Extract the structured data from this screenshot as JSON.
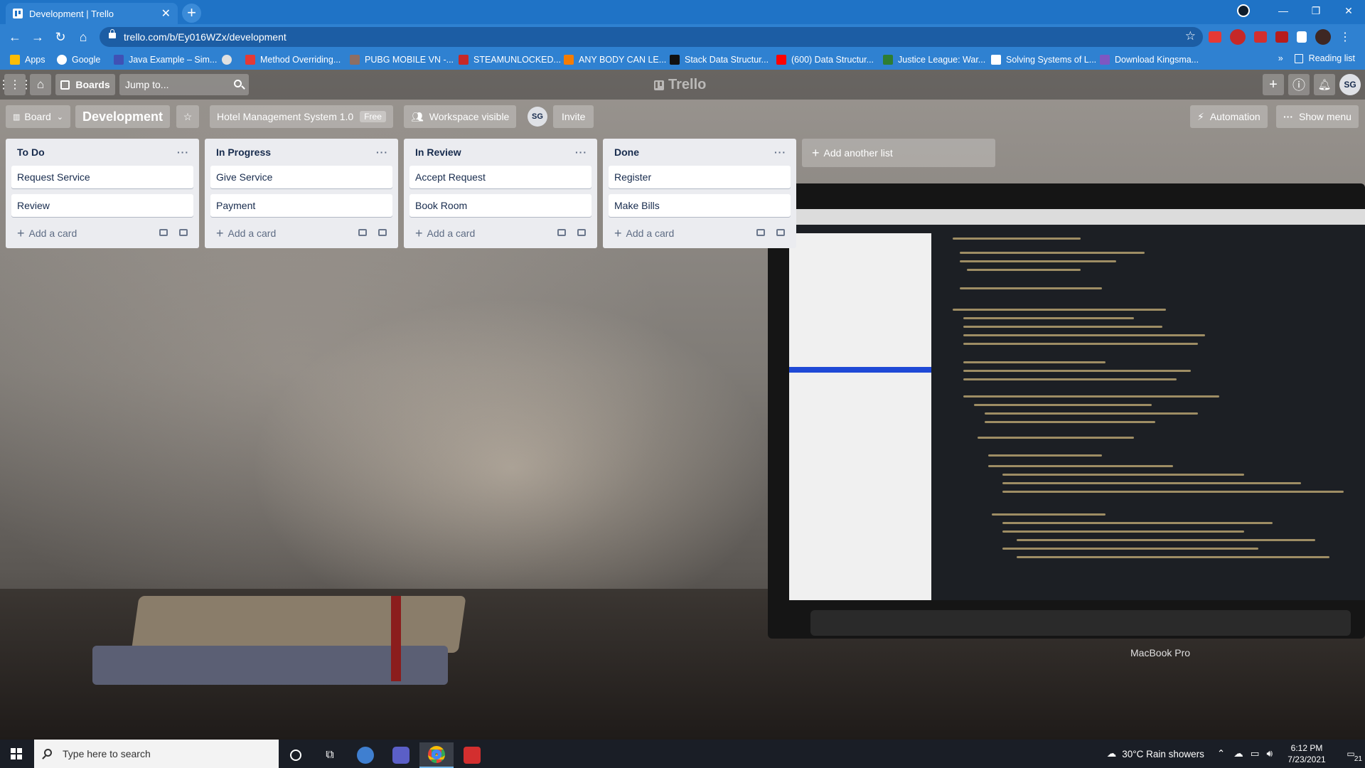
{
  "browser": {
    "tab_title": "Development | Trello",
    "tab_close": "✕",
    "new_tab": "+",
    "url": "trello.com/b/Ey016WZx/development",
    "window_controls": [
      "—",
      "❐",
      "✕"
    ]
  },
  "bookmarks": [
    {
      "label": "Apps",
      "color": "#fbbc05"
    },
    {
      "label": "Google",
      "color": "#ffffff"
    },
    {
      "label": "Java Example – Sim...",
      "color": "#3f51b5"
    },
    {
      "label": "",
      "color": "#e0e0e0"
    },
    {
      "label": "Method Overriding...",
      "color": "#e53935"
    },
    {
      "label": "PUBG MOBILE VN -...",
      "color": "#8d6e63"
    },
    {
      "label": "STEAMUNLOCKED...",
      "color": "#c62828"
    },
    {
      "label": "ANY BODY CAN LE...",
      "color": "#f57c00"
    },
    {
      "label": "Stack Data Structur...",
      "color": "#111111"
    },
    {
      "label": "(600) Data Structur...",
      "color": "#ff0000"
    },
    {
      "label": "Justice League: War...",
      "color": "#2e7d32"
    },
    {
      "label": "Solving Systems of L...",
      "color": "#ffffff"
    },
    {
      "label": "Download Kingsma...",
      "color": "#7e57c2"
    }
  ],
  "bookmarks_overflow": "»",
  "reading_list": "Reading list",
  "trello_header": {
    "boards_label": "Boards",
    "search_placeholder": "Jump to...",
    "logo_text": "Trello",
    "user_initials": "SG",
    "create_icon": "+",
    "info_icon": "ⓘ"
  },
  "board_bar": {
    "view_label": "Board",
    "board_name": "Development",
    "workspace_name": "Hotel Management System 1.0",
    "workspace_badge": "Free",
    "visibility_label": "Workspace visible",
    "member_initials": "SG",
    "invite_label": "Invite",
    "automation_label": "Automation",
    "show_menu_label": "Show menu"
  },
  "lists": [
    {
      "title": "To Do",
      "cards": [
        "Request Service",
        "Review"
      ]
    },
    {
      "title": "In Progress",
      "cards": [
        "Give Service",
        "Payment"
      ]
    },
    {
      "title": "In Review",
      "cards": [
        "Accept Request",
        "Book Room"
      ]
    },
    {
      "title": "Done",
      "cards": [
        "Register",
        "Make Bills"
      ]
    }
  ],
  "list_menu": "···",
  "add_card_label": "Add a card",
  "add_list_label": "Add another list",
  "photo": {
    "laptop_brand": "MacBook Pro"
  },
  "taskbar": {
    "search_placeholder": "Type here to search",
    "weather": "30°C  Rain showers",
    "time": "6:12 PM",
    "date": "7/23/2021",
    "notification_count": "21"
  }
}
